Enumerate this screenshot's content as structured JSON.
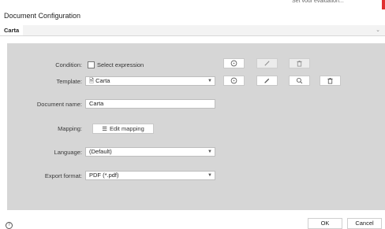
{
  "window": {
    "title": "Document Configuration",
    "topline": "Set your evaluation..."
  },
  "tabs": [
    {
      "label": "Carta"
    }
  ],
  "form": {
    "condition": {
      "label": "Condition:",
      "checkbox_label": "Select expression"
    },
    "template": {
      "label": "Template:",
      "value": "Carta",
      "icon": "document-icon"
    },
    "document_name": {
      "label": "Document name:",
      "value": "Carta"
    },
    "mapping": {
      "label": "Mapping:",
      "button_label": "Edit mapping"
    },
    "language": {
      "label": "Language:",
      "value": "(Default)"
    },
    "export_format": {
      "label": "Export format:",
      "value": "PDF (*.pdf)"
    }
  },
  "icons": {
    "row1": [
      "add-icon",
      "edit-icon",
      "delete-icon"
    ],
    "row2": [
      "add-icon",
      "edit-icon",
      "search-icon",
      "delete-icon"
    ]
  },
  "footer": {
    "ok_label": "OK",
    "cancel_label": "Cancel",
    "help": "?"
  },
  "colors": {
    "panel": "#d6d6d6",
    "close": "#e03030"
  }
}
